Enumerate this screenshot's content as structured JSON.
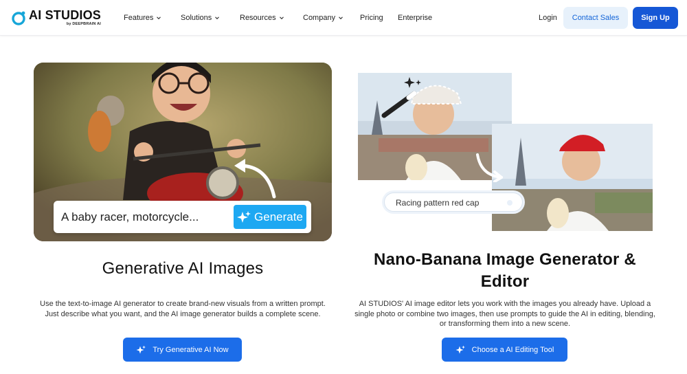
{
  "header": {
    "logo_text": "AI STUDIOS",
    "logo_sub": "by DEEPBRAIN AI",
    "nav": [
      {
        "label": "Features",
        "has_dropdown": true
      },
      {
        "label": "Solutions",
        "has_dropdown": true
      },
      {
        "label": "Resources",
        "has_dropdown": true
      },
      {
        "label": "Company",
        "has_dropdown": true
      },
      {
        "label": "Pricing",
        "has_dropdown": false
      },
      {
        "label": "Enterprise",
        "has_dropdown": false
      }
    ],
    "login_label": "Login",
    "contact_label": "Contact Sales",
    "signup_label": "Sign Up"
  },
  "left": {
    "prompt_text": "A baby racer, motorcycle...",
    "generate_label": "Generate",
    "title": "Generative AI Images",
    "description": "Use the text-to-image AI generator to create brand-new visuals from a written prompt. Just describe what you want, and the AI image generator builds a complete scene.",
    "cta_label": "Try Generative AI Now"
  },
  "right": {
    "edit_prompt_text": "Racing pattern red cap",
    "title": "Nano-Banana Image Generator & Editor",
    "description": "AI STUDIOS' AI image editor lets you work with the images you already have. Upload a single photo or combine two images, then use prompts to guide the AI in editing, blending, or transforming them into a new scene.",
    "cta_label": "Choose a AI Editing Tool"
  },
  "colors": {
    "brand_blue": "#1557d6",
    "cta_blue": "#1c6de9",
    "contact_bg": "#e7f1fb",
    "generate_blue": "#1da8f2",
    "logo_cyan": "#17a6d8"
  },
  "icons": [
    "logo-ring-icon",
    "chevron-down-icon",
    "sparkle-icon",
    "magic-wand-icon",
    "curved-arrow-icon"
  ]
}
